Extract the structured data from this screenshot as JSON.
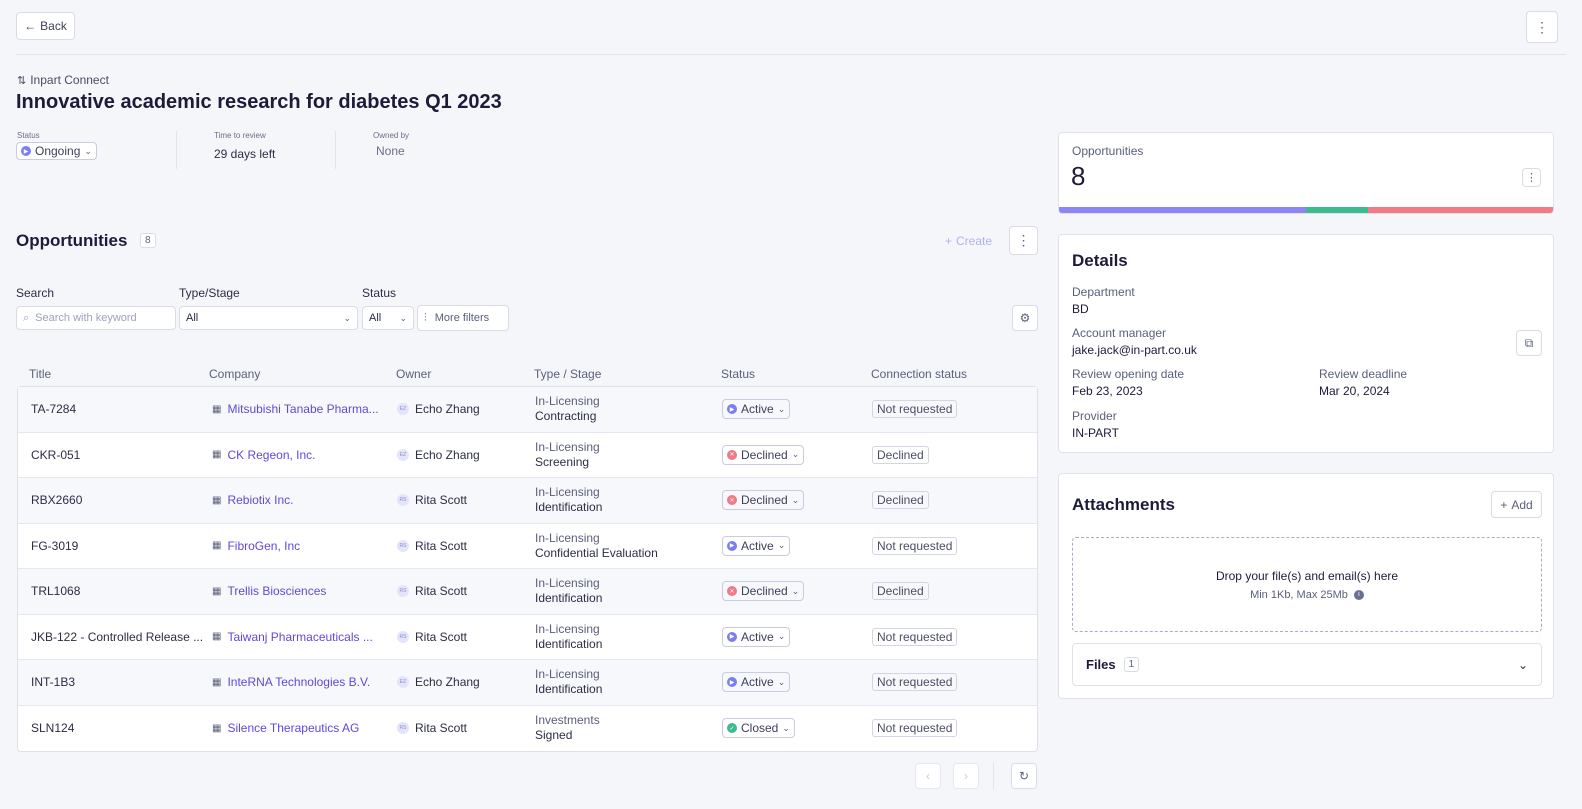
{
  "header": {
    "back_label": "Back",
    "more_icon": "vertical-dots-icon"
  },
  "breadcrumb": {
    "label": "Inpart Connect"
  },
  "page": {
    "title": "Innovative academic research for diabetes Q1 2023"
  },
  "meta": {
    "status_label": "Status",
    "status_value": "Ongoing",
    "time_label": "Time to review",
    "time_value": "29 days left",
    "owner_label": "Owned by",
    "owner_value": "None"
  },
  "opportunities_section": {
    "title": "Opportunities",
    "count": "8",
    "create_label": "Create"
  },
  "filters": {
    "search_label": "Search",
    "search_placeholder": "Search with keyword",
    "type_label": "Type/Stage",
    "type_value": "All",
    "status_label": "Status",
    "status_value": "All",
    "more_filters": "More filters"
  },
  "table": {
    "headers": [
      "Title",
      "Company",
      "Owner",
      "Type / Stage",
      "Status",
      "Connection status"
    ],
    "rows": [
      {
        "title": "TA-7284",
        "company": "Mitsubishi Tanabe Pharma...",
        "owner_initials": "EZ",
        "owner": "Echo Zhang",
        "type": "In-Licensing",
        "stage": "Contracting",
        "status": "Active",
        "conn": "Not requested"
      },
      {
        "title": "CKR-051",
        "company": "CK Regeon, Inc.",
        "owner_initials": "EZ",
        "owner": "Echo Zhang",
        "type": "In-Licensing",
        "stage": "Screening",
        "status": "Declined",
        "conn": "Declined"
      },
      {
        "title": "RBX2660",
        "company": "Rebiotix Inc.",
        "owner_initials": "RS",
        "owner": "Rita Scott",
        "type": "In-Licensing",
        "stage": "Identification",
        "status": "Declined",
        "conn": "Declined"
      },
      {
        "title": "FG-3019",
        "company": "FibroGen, Inc",
        "owner_initials": "RS",
        "owner": "Rita Scott",
        "type": "In-Licensing",
        "stage": "Confidential Evaluation",
        "status": "Active",
        "conn": "Not requested"
      },
      {
        "title": "TRL1068",
        "company": "Trellis Biosciences",
        "owner_initials": "RS",
        "owner": "Rita Scott",
        "type": "In-Licensing",
        "stage": "Identification",
        "status": "Declined",
        "conn": "Declined"
      },
      {
        "title": "JKB-122 - Controlled Release ...",
        "company": "Taiwanj Pharmaceuticals ...",
        "owner_initials": "RS",
        "owner": "Rita Scott",
        "type": "In-Licensing",
        "stage": "Identification",
        "status": "Active",
        "conn": "Not requested"
      },
      {
        "title": "INT-1B3",
        "company": "InteRNA Technologies B.V.",
        "owner_initials": "EZ",
        "owner": "Echo Zhang",
        "type": "In-Licensing",
        "stage": "Identification",
        "status": "Active",
        "conn": "Not requested"
      },
      {
        "title": "SLN124",
        "company": "Silence Therapeutics AG",
        "owner_initials": "RS",
        "owner": "Rita Scott",
        "type": "Investments",
        "stage": "Signed",
        "status": "Closed",
        "conn": "Not requested"
      }
    ]
  },
  "summary": {
    "label": "Opportunities",
    "value": "8",
    "segments": [
      {
        "status": "Active",
        "count": 4,
        "color": "#8b85f5"
      },
      {
        "status": "Closed",
        "count": 1,
        "color": "#3dbb8f"
      },
      {
        "status": "Declined",
        "count": 3,
        "color": "#f07a86"
      }
    ]
  },
  "details": {
    "title": "Details",
    "department_label": "Department",
    "department": "BD",
    "account_label": "Account manager",
    "account": "jake.jack@in-part.co.uk",
    "opening_label": "Review opening date",
    "opening": "Feb 23, 2023",
    "deadline_label": "Review deadline",
    "deadline": "Mar 20, 2024",
    "provider_label": "Provider",
    "provider": "IN-PART"
  },
  "attachments": {
    "title": "Attachments",
    "add_label": "Add",
    "drop_text": "Drop your file(s) and email(s) here",
    "limits": "Min 1Kb, Max 25Mb",
    "files_label": "Files",
    "files_count": "1"
  },
  "colors": {
    "accent": "#5d4ad9",
    "active": "#7b7ef0",
    "declined": "#f07a86",
    "closed": "#3dbb8f"
  }
}
